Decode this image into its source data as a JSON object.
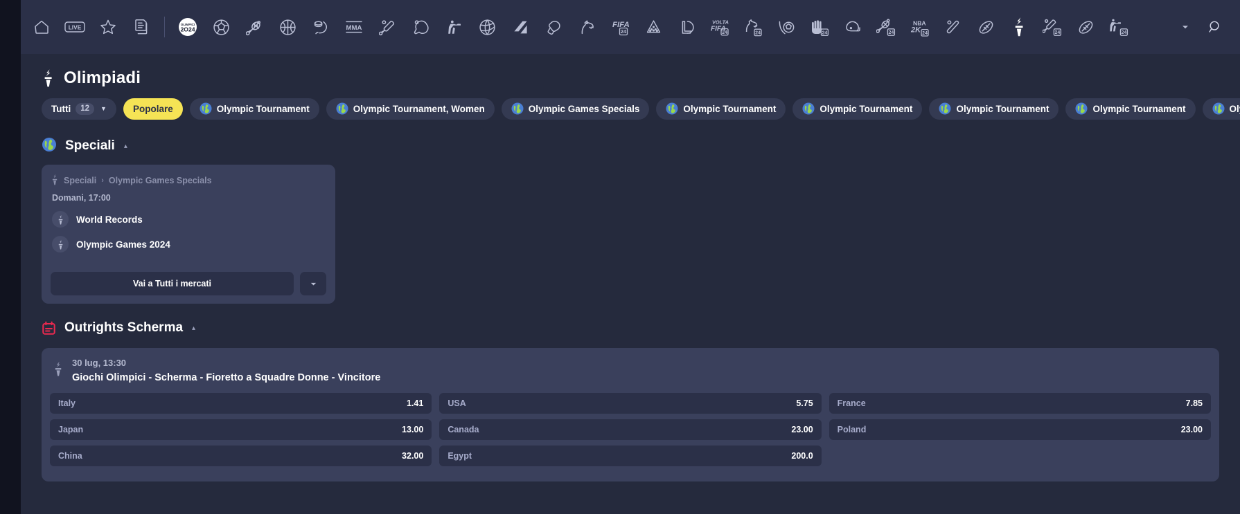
{
  "sportnav": {
    "items": [
      {
        "name": "home-icon",
        "label": "Home",
        "active": false
      },
      {
        "name": "live-icon",
        "label": "Live",
        "active": false
      },
      {
        "name": "star-icon",
        "label": "Preferiti",
        "active": false
      },
      {
        "name": "coupons-icon",
        "label": "Schedine",
        "active": false
      },
      {
        "name": "separator",
        "label": "",
        "active": false
      },
      {
        "name": "olympics-2024-icon",
        "label": "Olimpiadi 2024",
        "active": false
      },
      {
        "name": "football-icon",
        "label": "Calcio",
        "active": false
      },
      {
        "name": "tennis-icon",
        "label": "Tennis",
        "active": false
      },
      {
        "name": "basketball-icon",
        "label": "Basket",
        "active": false
      },
      {
        "name": "ice-hockey-icon",
        "label": "Hockey su ghiaccio",
        "active": false
      },
      {
        "name": "mma-icon",
        "label": "MMA",
        "active": false
      },
      {
        "name": "cricket-icon",
        "label": "Cricket",
        "active": false
      },
      {
        "name": "table-tennis-icon",
        "label": "Tennis tavolo",
        "active": false
      },
      {
        "name": "counter-strike-icon",
        "label": "Counter-Strike",
        "active": false
      },
      {
        "name": "volleyball-icon",
        "label": "Pallavolo",
        "active": false
      },
      {
        "name": "dota-icon",
        "label": "Dota 2",
        "active": false
      },
      {
        "name": "boxing-icon",
        "label": "Boxe",
        "active": false
      },
      {
        "name": "horse-racing-icon",
        "label": "Ippica",
        "active": false
      },
      {
        "name": "fifa-24-icon",
        "label": "FIFA 24",
        "active": false
      },
      {
        "name": "darts-icon",
        "label": "Freccette",
        "active": false
      },
      {
        "name": "league-of-legends-icon",
        "label": "League of Legends",
        "active": false
      },
      {
        "name": "volta-fifa-24-icon",
        "label": "Volta FIFA 24",
        "active": false
      },
      {
        "name": "horse-racing-24-icon",
        "label": "Ippica 24",
        "active": false
      },
      {
        "name": "efootball-icon",
        "label": "eFootball",
        "active": false
      },
      {
        "name": "basketball-24-icon",
        "label": "Basket 24",
        "active": false
      },
      {
        "name": "american-football-helmet-icon",
        "label": "Football americano",
        "active": false
      },
      {
        "name": "tennis-24-icon",
        "label": "Tennis 24",
        "active": false
      },
      {
        "name": "nba-2k-24-icon",
        "label": "NBA 2K24",
        "active": false
      },
      {
        "name": "baseball-icon",
        "label": "Baseball",
        "active": false
      },
      {
        "name": "rugby-icon",
        "label": "Rugby",
        "active": false
      },
      {
        "name": "olympics-torch-icon",
        "label": "Olimpiadi",
        "active": true
      },
      {
        "name": "cricket-24-icon",
        "label": "Cricket 24",
        "active": false
      },
      {
        "name": "rugby-league-icon",
        "label": "Rugby League",
        "active": false
      },
      {
        "name": "shooting-24-icon",
        "label": "Tiro 24",
        "active": false
      }
    ],
    "more_caret": "▾",
    "search_icon": "search-icon"
  },
  "header": {
    "icon": "olympics-torch-icon",
    "title": "Olimpiadi"
  },
  "filters": {
    "all": {
      "label": "Tutti",
      "count": "12",
      "caret": "▾"
    },
    "chips": [
      {
        "label": "Popolare",
        "highlight": true,
        "icon": null
      },
      {
        "label": "Olympic Tournament",
        "highlight": false,
        "icon": "globe-icon"
      },
      {
        "label": "Olympic Tournament, Women",
        "highlight": false,
        "icon": "globe-icon"
      },
      {
        "label": "Olympic Games Specials",
        "highlight": false,
        "icon": "globe-icon"
      },
      {
        "label": "Olympic Tournament",
        "highlight": false,
        "icon": "globe-icon"
      },
      {
        "label": "Olympic Tournament",
        "highlight": false,
        "icon": "globe-icon"
      },
      {
        "label": "Olympic Tournament",
        "highlight": false,
        "icon": "globe-icon"
      },
      {
        "label": "Olympic Tournament",
        "highlight": false,
        "icon": "globe-icon"
      },
      {
        "label": "Olympic Tournament",
        "highlight": false,
        "icon": "globe-icon"
      }
    ]
  },
  "speciali": {
    "icon": "globe-icon",
    "title": "Speciali",
    "collapse_caret": "▴",
    "card": {
      "breadcrumb_icon": "olympics-torch-icon",
      "breadcrumb_root": "Speciali",
      "breadcrumb_sep": "›",
      "breadcrumb_leaf": "Olympic Games Specials",
      "time": "Domani, 17:00",
      "markets": [
        {
          "icon": "olympics-torch-icon",
          "label": "World Records"
        },
        {
          "icon": "olympics-torch-icon",
          "label": "Olympic Games 2024"
        }
      ],
      "primary_button": "Vai a Tutti i mercati",
      "more_button_caret": "▾"
    }
  },
  "outrights": {
    "icon": "calendar-icon",
    "title": "Outrights Scherma",
    "collapse_caret": "▴",
    "accent_color": "#e8294f",
    "event": {
      "icon": "olympics-torch-icon",
      "time": "30 lug, 13:30",
      "title": "Giochi Olimpici - Scherma - Fioretto a Squadre Donne - Vincitore"
    },
    "odds": [
      {
        "name": "Italy",
        "value": "1.41"
      },
      {
        "name": "USA",
        "value": "5.75"
      },
      {
        "name": "France",
        "value": "7.85"
      },
      {
        "name": "Japan",
        "value": "13.00"
      },
      {
        "name": "Canada",
        "value": "23.00"
      },
      {
        "name": "Poland",
        "value": "23.00"
      },
      {
        "name": "China",
        "value": "32.00"
      },
      {
        "name": "Egypt",
        "value": "200.0"
      }
    ]
  },
  "colors": {
    "page_bg": "#252a3d",
    "nav_bg": "#2b3048",
    "card_bg": "#3a405c",
    "button_bg": "#2b3048",
    "accent_yellow": "#f5e355",
    "accent_red": "#e8294f",
    "text_primary": "#ffffff",
    "text_muted": "#a7accb"
  }
}
